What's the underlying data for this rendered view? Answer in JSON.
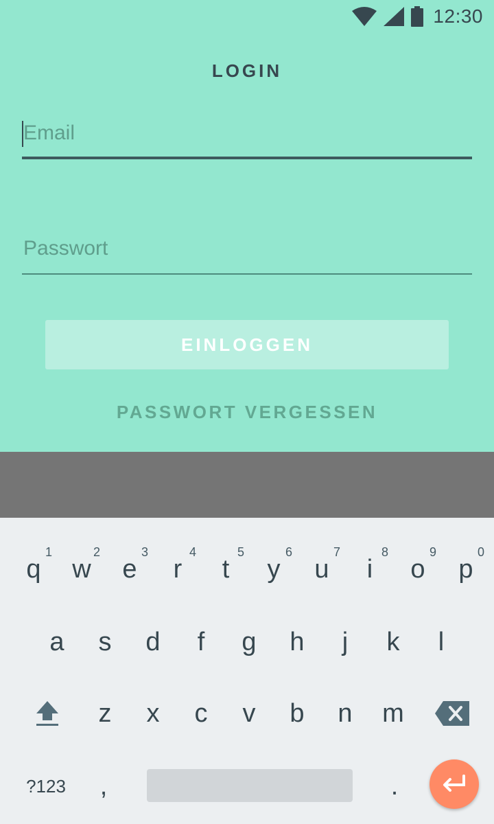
{
  "status": {
    "time": "12:30"
  },
  "login": {
    "title": "LOGIN",
    "email_placeholder": "Email",
    "password_placeholder": "Passwort",
    "login_button": "EINLOGGEN",
    "forgot_link": "PASSWORT VERGESSEN"
  },
  "keyboard": {
    "row1": [
      {
        "key": "q",
        "hint": "1"
      },
      {
        "key": "w",
        "hint": "2"
      },
      {
        "key": "e",
        "hint": "3"
      },
      {
        "key": "r",
        "hint": "4"
      },
      {
        "key": "t",
        "hint": "5"
      },
      {
        "key": "y",
        "hint": "6"
      },
      {
        "key": "u",
        "hint": "7"
      },
      {
        "key": "i",
        "hint": "8"
      },
      {
        "key": "o",
        "hint": "9"
      },
      {
        "key": "p",
        "hint": "0"
      }
    ],
    "row2": [
      "a",
      "s",
      "d",
      "f",
      "g",
      "h",
      "j",
      "k",
      "l"
    ],
    "row3": [
      "z",
      "x",
      "c",
      "v",
      "b",
      "n",
      "m"
    ],
    "symbols_label": "?123",
    "comma": ",",
    "period": ".",
    "icons": {
      "shift": "shift-icon",
      "backspace": "backspace-icon",
      "enter": "enter-icon"
    }
  },
  "colors": {
    "background": "#93e7cf",
    "accent": "#ff8a65",
    "text": "#37474f"
  }
}
